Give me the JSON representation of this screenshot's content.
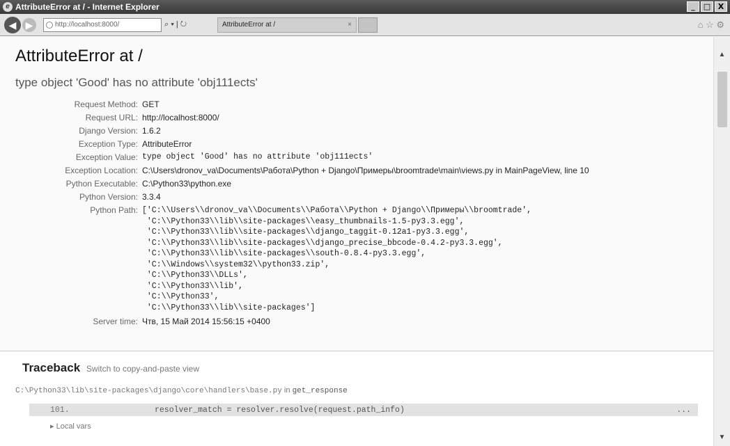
{
  "window": {
    "title": "AttributeError at / - Internet Explorer",
    "minimize": "_",
    "maximize": "□",
    "close": "X"
  },
  "browser": {
    "back": "◀",
    "forward": "▶",
    "address": "http://localhost:8000/",
    "address_tools": "⌕ ▾ | ↻",
    "tab_title": "AttributeError at /",
    "tab_close": "×",
    "tools": "⌂ ☆ ⚙"
  },
  "error": {
    "title": "AttributeError at /",
    "message": "type object 'Good' has no attribute 'obj111ects'"
  },
  "meta": [
    {
      "label": "Request Method:",
      "value": "GET"
    },
    {
      "label": "Request URL:",
      "value": "http://localhost:8000/"
    },
    {
      "label": "Django Version:",
      "value": "1.6.2"
    },
    {
      "label": "Exception Type:",
      "value": "AttributeError"
    },
    {
      "label": "Exception Value:",
      "value": "type object 'Good' has no attribute 'obj111ects'"
    },
    {
      "label": "Exception Location:",
      "value": "C:\\Users\\dronov_va\\Documents\\Работа\\Python + Django\\Примеры\\broomtrade\\main\\views.py in MainPageView, line 10"
    },
    {
      "label": "Python Executable:",
      "value": "C:\\Python33\\python.exe"
    },
    {
      "label": "Python Version:",
      "value": "3.3.4"
    },
    {
      "label": "Python Path:",
      "value": "['C:\\\\Users\\\\dronov_va\\\\Documents\\\\Работа\\\\Python + Django\\\\Примеры\\\\broomtrade',\n 'C:\\\\Python33\\\\lib\\\\site-packages\\\\easy_thumbnails-1.5-py3.3.egg',\n 'C:\\\\Python33\\\\lib\\\\site-packages\\\\django_taggit-0.12a1-py3.3.egg',\n 'C:\\\\Python33\\\\lib\\\\site-packages\\\\django_precise_bbcode-0.4.2-py3.3.egg',\n 'C:\\\\Python33\\\\lib\\\\site-packages\\\\south-0.8.4-py3.3.egg',\n 'C:\\\\Windows\\\\system32\\\\python33.zip',\n 'C:\\\\Python33\\\\DLLs',\n 'C:\\\\Python33\\\\lib',\n 'C:\\\\Python33',\n 'C:\\\\Python33\\\\lib\\\\site-packages']"
    },
    {
      "label": "Server time:",
      "value": "Чтв, 15 Май 2014 15:56:15 +0400"
    }
  ],
  "traceback": {
    "heading": "Traceback",
    "switch_link": "Switch to copy-and-paste view",
    "frame_file": "C:\\Python33\\lib\\site-packages\\django\\core\\handlers\\base.py",
    "frame_in": " in ",
    "frame_function": "get_response",
    "line_number": "101.",
    "code": "resolver_match = resolver.resolve(request.path_info)",
    "dots": "...",
    "local_vars": "▸ Local vars"
  },
  "scrollbar": {
    "up": "▲",
    "down": "▼"
  }
}
